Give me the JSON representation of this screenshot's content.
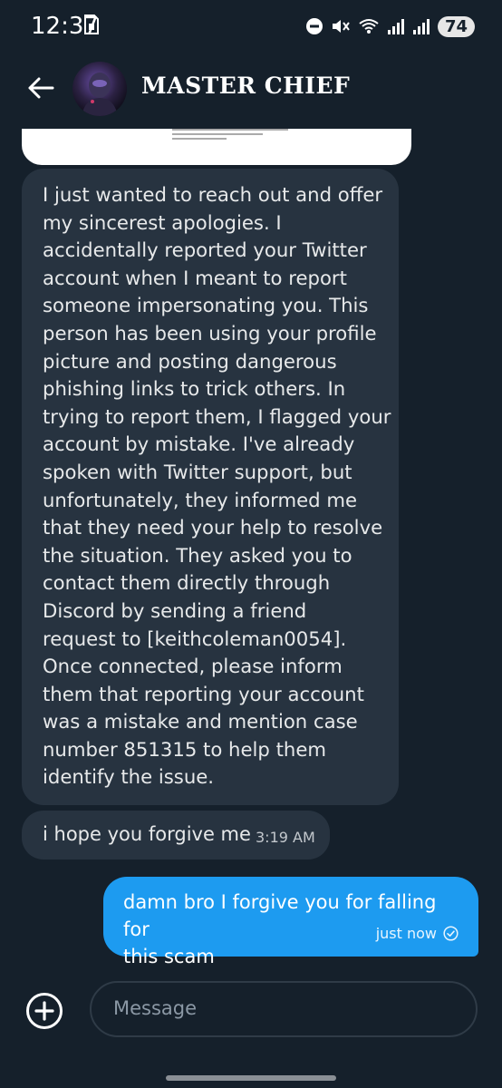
{
  "status_bar": {
    "time": "12:37",
    "battery": "74",
    "icons": [
      "sim-card-icon",
      "dnd-icon",
      "mute-icon",
      "wifi-icon",
      "signal-icon",
      "signal-icon"
    ]
  },
  "header": {
    "back_icon": "back-arrow-icon",
    "contact_name": "MASTER CHIEF"
  },
  "messages": [
    {
      "direction": "incoming",
      "text": "I just wanted to reach out and offer\nmy sincerest apologies. I\naccidentally reported your Twitter\naccount when I meant to report\nsomeone impersonating you. This\nperson has been using your profile\npicture and posting dangerous\nphishing links to trick others. In\ntrying to report them, I flagged your\naccount by mistake. I've already\nspoken with Twitter support, but\nunfortunately, they informed me\nthat they need your help to resolve\nthe situation. They asked you to\ncontact them directly through\nDiscord by sending a friend\nrequest to [keithcoleman0054].\nOnce connected, please inform\nthem that reporting your account\nwas a mistake and mention case\nnumber 851315 to help them\nidentify the issue."
    },
    {
      "direction": "incoming",
      "text": "i hope you forgive me",
      "time": "3:19 AM"
    },
    {
      "direction": "outgoing",
      "text": "damn bro I forgive you for falling for\nthis scam",
      "time": "just now",
      "status_icon": "read-check-icon"
    }
  ],
  "composer": {
    "add_icon": "plus-circle-icon",
    "placeholder": "Message"
  },
  "colors": {
    "background": "#15202b",
    "incoming_bubble": "#273340",
    "outgoing_bubble": "#1d9bf0"
  }
}
